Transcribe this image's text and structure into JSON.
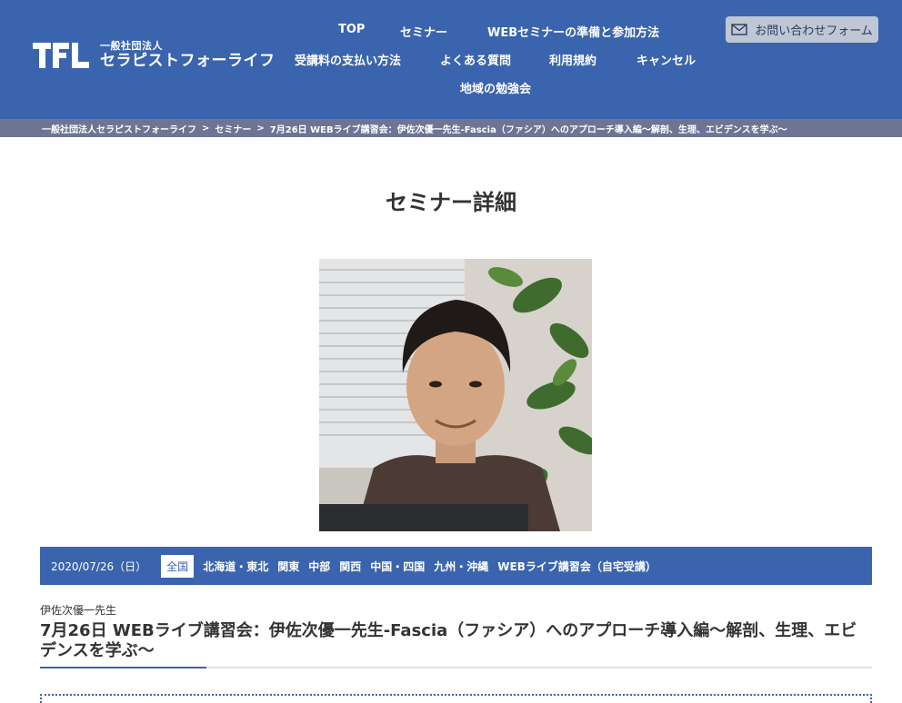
{
  "header": {
    "logo_mark": "TFL",
    "logo_sub": "一般社団法人",
    "logo_main": "セラピストフォーライフ",
    "nav": [
      "TOP",
      "セミナー",
      "WEBセミナーの準備と参加方法",
      "受講料の支払い方法",
      "よくある質問",
      "利用規約",
      "キャンセル",
      "地域の勉強会"
    ],
    "contact_label": "お問い合わせフォーム",
    "contact_icon": "mail-icon"
  },
  "breadcrumb": {
    "items": [
      "一般社団法人セラピストフォーライフ",
      "セミナー",
      "7月26日 WEBライブ講習会：伊佐次優一先生-Fascia（ファシア）へのアプローチ導入編〜解剖、生理、エビデンスを学ぶ〜"
    ],
    "separator": ">"
  },
  "page_title": "セミナー詳細",
  "info_bar": {
    "date": "2020/07/26（日）",
    "regions": [
      "全国",
      "北海道・東北",
      "関東",
      "中部",
      "関西",
      "中国・四国",
      "九州・沖縄",
      "WEBライブ講習会（自宅受講）"
    ],
    "active_region": "全国"
  },
  "seminar": {
    "teacher": "伊佐次優一先生",
    "title": "7月26日 WEBライブ講習会：伊佐次優一先生-Fascia（ファシア）へのアプローチ導入編〜解剖、生理、エビデンスを学ぶ〜"
  },
  "colors": {
    "brand_blue": "#3a64ae",
    "breadcrumb_bg": "#6e7594",
    "contact_bg": "#bfc7d5"
  }
}
